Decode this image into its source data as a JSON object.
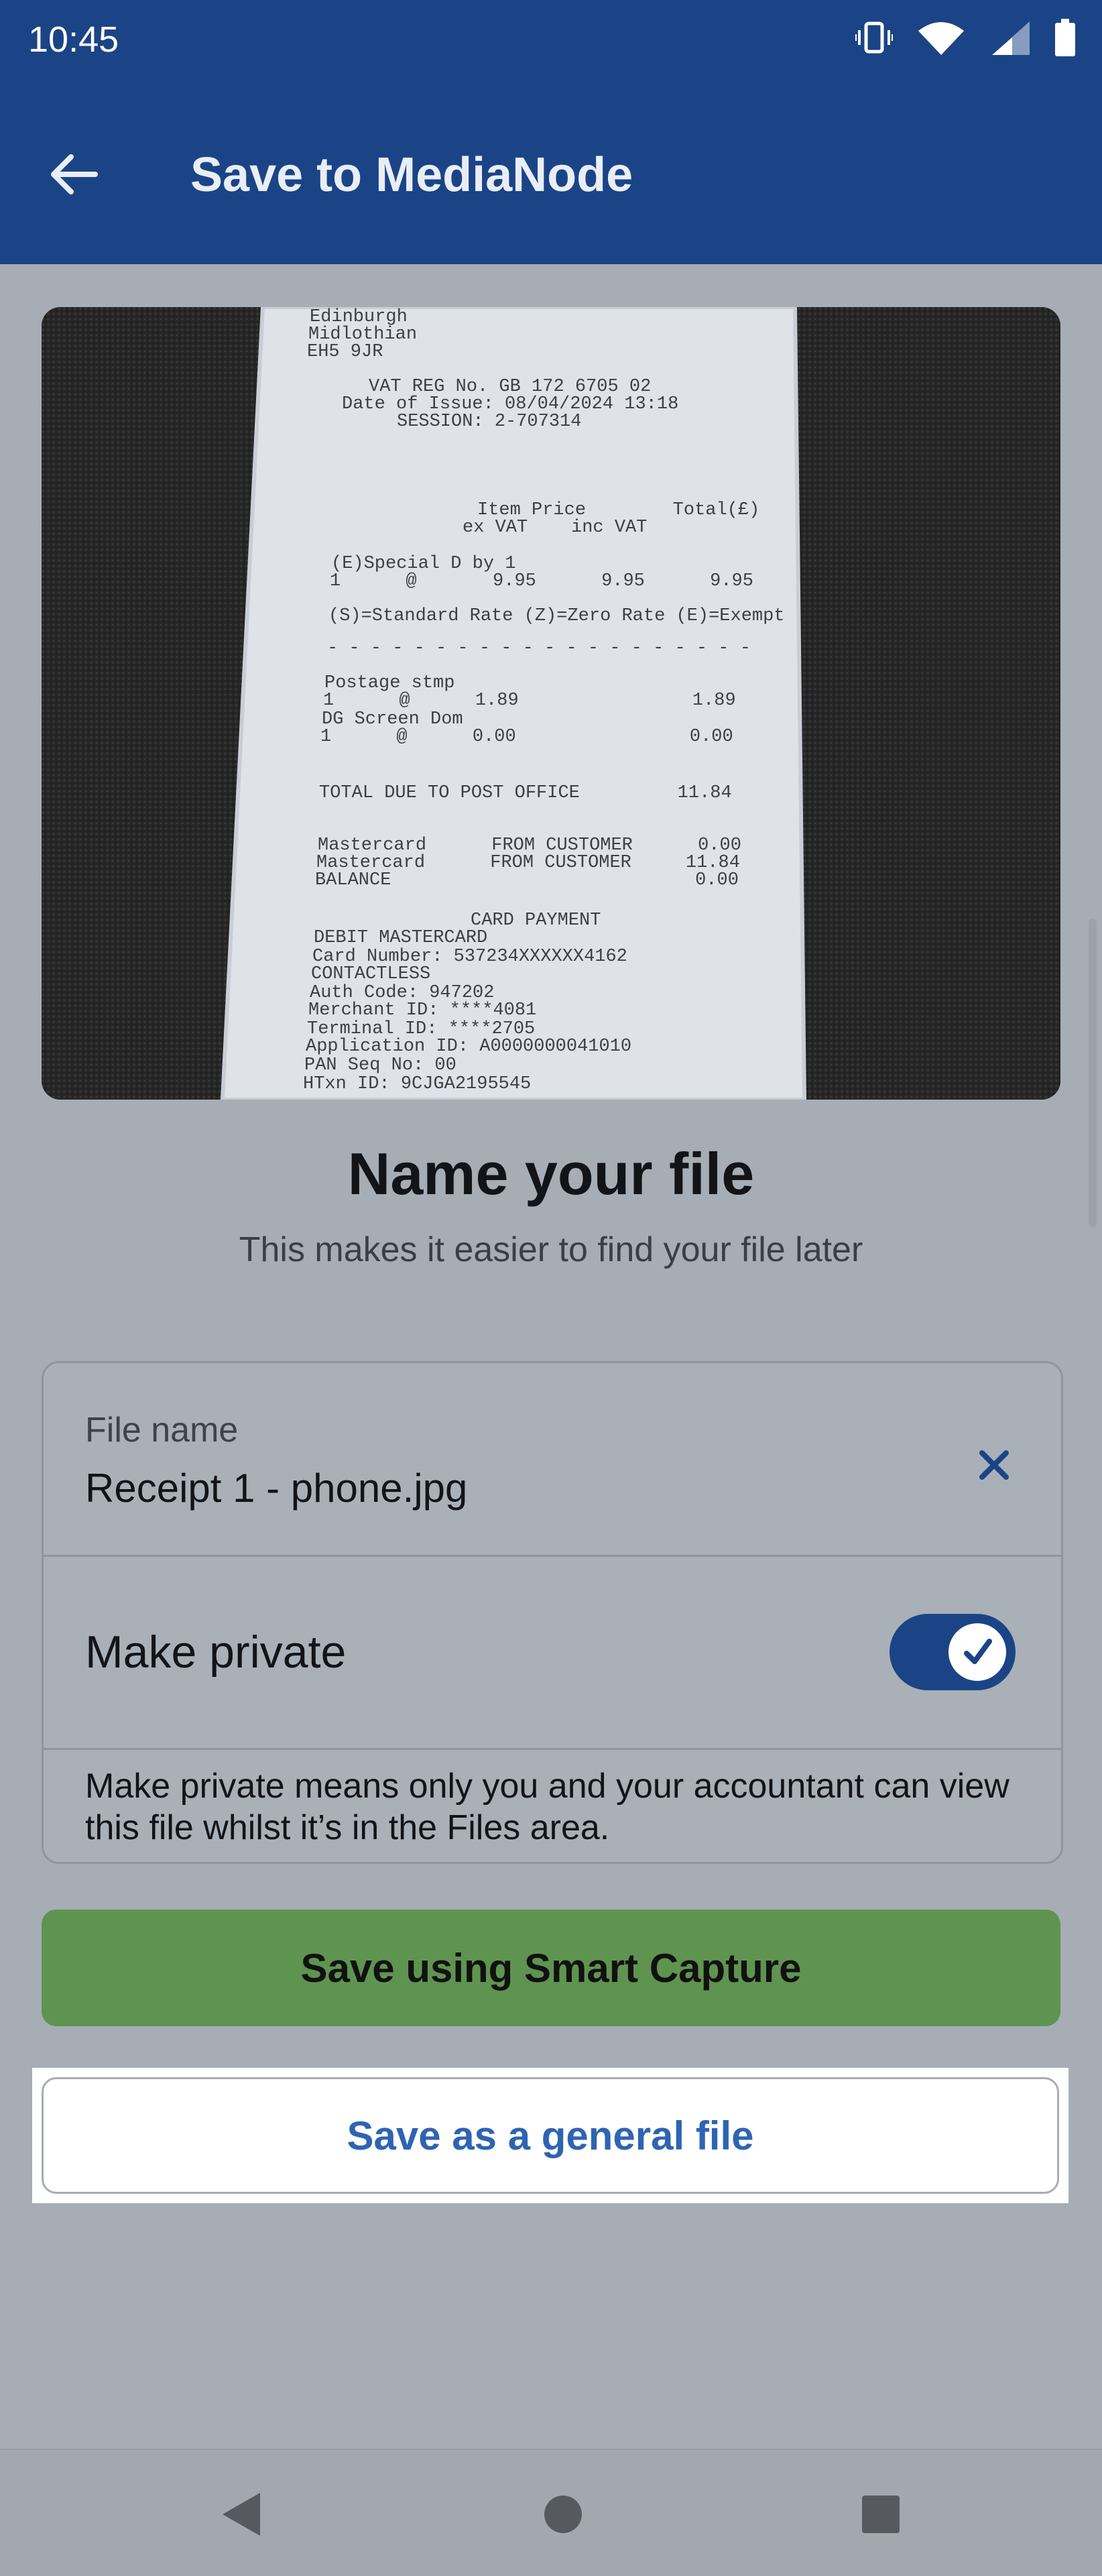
{
  "status_bar": {
    "time": "10:45"
  },
  "app_bar": {
    "title": "Save to MediaNode"
  },
  "receipt": {
    "lines": [
      "Edinburgh",
      "Midlothian",
      "EH5 9JR",
      "VAT REG No. GB 172 6705 02",
      "Date of Issue: 08/04/2024 13:18",
      "SESSION: 2-707314",
      "Item Price        Total(£)",
      "ex VAT    inc VAT",
      "(E)Special D by 1",
      "1      @       9.95      9.95      9.95",
      "(S)=Standard Rate (Z)=Zero Rate (E)=Exempt",
      "- - - - - - - - - - - - - - - - - - - -",
      "Postage stmp",
      "1      @      1.89                1.89",
      "DG Screen Dom",
      "1      @      0.00                0.00",
      "TOTAL DUE TO POST OFFICE         11.84",
      "Mastercard      FROM CUSTOMER      0.00",
      "Mastercard      FROM CUSTOMER     11.84",
      "BALANCE                            0.00",
      "CARD PAYMENT",
      "DEBIT MASTERCARD",
      "Card Number: 537234XXXXXX4162",
      "CONTACTLESS",
      "Auth Code: 947202",
      "Merchant ID: ****4081",
      "Terminal ID: ****2705",
      "Application ID: A0000000041010",
      "PAN Seq No: 00",
      "HTxn ID: 9CJGA2195545"
    ]
  },
  "heading": {
    "title": "Name your file",
    "subtitle": "This makes it easier to find your file later"
  },
  "form": {
    "file_name_label": "File name",
    "file_name_value": "Receipt 1 - phone.jpg",
    "make_private_label": "Make private",
    "make_private_on": true,
    "help_text": "Make private means only you and your accountant can view this file whilst it’s in the Files area."
  },
  "actions": {
    "smart_capture_label": "Save using Smart Capture",
    "general_file_label": "Save as a general file"
  },
  "colors": {
    "primary": "#1b4487",
    "accent_green": "#5f9450",
    "link_blue": "#2f64b2"
  }
}
